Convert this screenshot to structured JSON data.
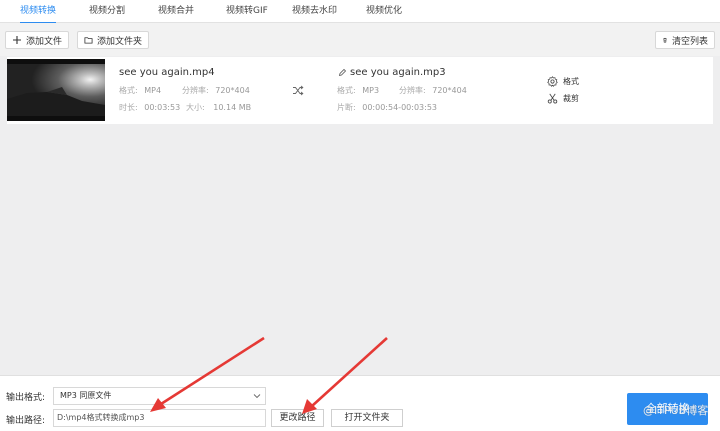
{
  "tabs": [
    {
      "label": "视频转换",
      "active": true
    },
    {
      "label": "视频分割",
      "active": false
    },
    {
      "label": "视频合并",
      "active": false
    },
    {
      "label": "视频转GIF",
      "active": false
    },
    {
      "label": "视频去水印",
      "active": false
    },
    {
      "label": "视频优化",
      "active": false
    }
  ],
  "toolbar": {
    "add_file": "添加文件",
    "add_folder": "添加文件夹",
    "clear_list": "清空列表"
  },
  "file": {
    "source_name": "see you again.mp4",
    "source_format_label": "格式:",
    "source_format": "MP4",
    "source_resolution_label": "分辨率:",
    "source_resolution": "720*404",
    "source_duration_label": "时长:",
    "source_duration": "00:03:53",
    "source_size_label": "大小:",
    "source_size": "10.14 MB",
    "target_name": "see you again.mp3",
    "target_format_label": "格式:",
    "target_format": "MP3",
    "target_resolution_label": "分辨率:",
    "target_resolution": "720*404",
    "target_clip_label": "片断:",
    "target_clip": "00:00:54-00:03:53",
    "action_format": "格式",
    "action_trim": "裁剪"
  },
  "bottom": {
    "output_format_label": "输出格式:",
    "output_format_value": "MP3  同原文件",
    "output_path_label": "输出路径:",
    "output_path_value": "D:\\mp4格式转换成mp3",
    "change_path": "更改路径",
    "open_folder": "打开文件夹",
    "convert_all": "全部转换"
  },
  "watermark": "@ITPUB博客",
  "colors": {
    "accent": "#2d8cf0",
    "annotation_arrow": "#e53935"
  }
}
